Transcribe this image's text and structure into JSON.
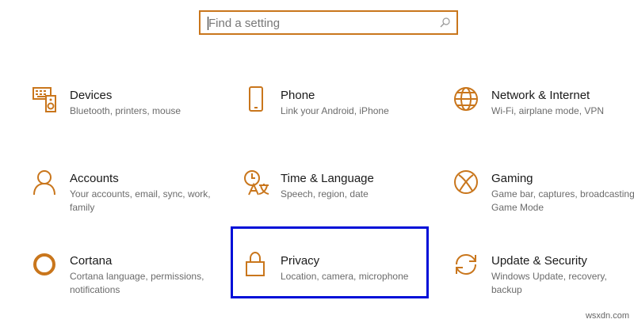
{
  "search": {
    "placeholder": "Find a setting",
    "value": ""
  },
  "accent_color": "#c9761c",
  "selection_color": "#0010d8",
  "tiles": [
    {
      "title": "Devices",
      "description": "Bluetooth, printers, mouse",
      "icon": "keyboard-speaker-icon"
    },
    {
      "title": "Phone",
      "description": "Link your Android, iPhone",
      "icon": "phone-icon"
    },
    {
      "title": "Network & Internet",
      "description": "Wi-Fi, airplane mode, VPN",
      "icon": "globe-icon"
    },
    {
      "title": "Accounts",
      "description": "Your accounts, email, sync, work, family",
      "icon": "person-icon"
    },
    {
      "title": "Time & Language",
      "description": "Speech, region, date",
      "icon": "time-language-icon"
    },
    {
      "title": "Gaming",
      "description": "Game bar, captures, broadcasting, Game Mode",
      "icon": "xbox-icon"
    },
    {
      "title": "Cortana",
      "description": "Cortana language, permissions, notifications",
      "icon": "cortana-ring-icon"
    },
    {
      "title": "Privacy",
      "description": "Location, camera, microphone",
      "icon": "lock-icon",
      "selected": true
    },
    {
      "title": "Update & Security",
      "description": "Windows Update, recovery, backup",
      "icon": "sync-arrows-icon"
    }
  ],
  "watermark": "wsxdn.com"
}
